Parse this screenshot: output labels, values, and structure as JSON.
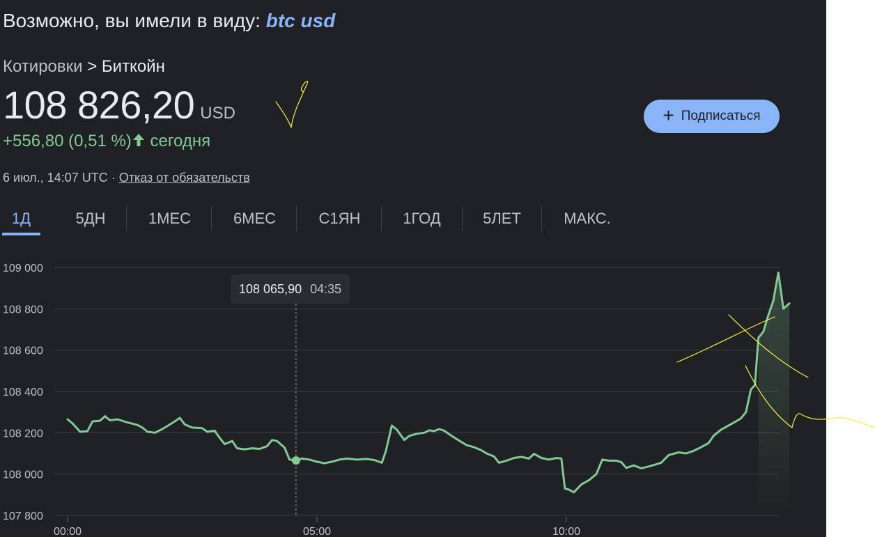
{
  "header": {
    "did_you_mean_prefix": "Возможно, вы имели в виду: ",
    "did_you_mean_query": "btc usd"
  },
  "breadcrumb": {
    "root": "Котировки",
    "separator": " > ",
    "current": "Биткойн"
  },
  "quote": {
    "price": "108 826,20",
    "currency": "USD",
    "change": "+556,80 (0,51 %)",
    "change_suffix": " сегодня",
    "timestamp": "6 июл., 14:07 UTC · ",
    "disclaimer": "Отказ от обязательств"
  },
  "subscribe_label": "Подписаться",
  "tabs": [
    "1Д",
    "5ДН",
    "1МЕС",
    "6МЕС",
    "С1ЯН",
    "1ГОД",
    "5ЛЕТ",
    "МАКС."
  ],
  "active_tab": "1Д",
  "tooltip": {
    "value": "108 065,90",
    "time": "04:35"
  },
  "colors": {
    "line": "#81c995",
    "accent": "#8ab4f8",
    "background": "#202124",
    "annotation": "#f5ef3b"
  },
  "chart_data": {
    "type": "line",
    "yticks": [
      "109 000",
      "108 800",
      "108 600",
      "108 400",
      "108 200",
      "108 000",
      "107 800"
    ],
    "ytick_values": [
      109000,
      108800,
      108600,
      108400,
      108200,
      108000,
      107800
    ],
    "xticks": [
      "00:00",
      "05:00",
      "10:00"
    ],
    "xtick_hours": [
      0,
      5,
      10
    ],
    "ylim": [
      107800,
      109000
    ],
    "grid": true,
    "hover_point": {
      "t": "04:35",
      "value": 108065.9
    },
    "series": [
      {
        "values": [
          [
            0.0,
            108265
          ],
          [
            0.1,
            108245
          ],
          [
            0.25,
            108205
          ],
          [
            0.4,
            108208
          ],
          [
            0.5,
            108255
          ],
          [
            0.65,
            108258
          ],
          [
            0.75,
            108280
          ],
          [
            0.85,
            108260
          ],
          [
            1.0,
            108265
          ],
          [
            1.2,
            108250
          ],
          [
            1.4,
            108238
          ],
          [
            1.5,
            108225
          ],
          [
            1.6,
            108205
          ],
          [
            1.75,
            108200
          ],
          [
            1.9,
            108218
          ],
          [
            2.05,
            108240
          ],
          [
            2.15,
            108255
          ],
          [
            2.25,
            108272
          ],
          [
            2.35,
            108240
          ],
          [
            2.5,
            108225
          ],
          [
            2.7,
            108222
          ],
          [
            2.8,
            108205
          ],
          [
            2.95,
            108210
          ],
          [
            3.05,
            108175
          ],
          [
            3.15,
            108145
          ],
          [
            3.3,
            108160
          ],
          [
            3.4,
            108125
          ],
          [
            3.55,
            108120
          ],
          [
            3.7,
            108125
          ],
          [
            3.85,
            108122
          ],
          [
            4.0,
            108135
          ],
          [
            4.1,
            108165
          ],
          [
            4.2,
            108160
          ],
          [
            4.35,
            108128
          ],
          [
            4.45,
            108070
          ],
          [
            4.58,
            108066
          ],
          [
            4.7,
            108075
          ],
          [
            4.85,
            108070
          ],
          [
            5.0,
            108060
          ],
          [
            5.15,
            108052
          ],
          [
            5.3,
            108060
          ],
          [
            5.45,
            108070
          ],
          [
            5.6,
            108075
          ],
          [
            5.8,
            108070
          ],
          [
            6.0,
            108073
          ],
          [
            6.15,
            108068
          ],
          [
            6.3,
            108055
          ],
          [
            6.38,
            108110
          ],
          [
            6.5,
            108235
          ],
          [
            6.6,
            108215
          ],
          [
            6.75,
            108165
          ],
          [
            6.85,
            108185
          ],
          [
            7.0,
            108195
          ],
          [
            7.15,
            108200
          ],
          [
            7.25,
            108212
          ],
          [
            7.35,
            108208
          ],
          [
            7.45,
            108218
          ],
          [
            7.55,
            108210
          ],
          [
            7.7,
            108185
          ],
          [
            7.85,
            108162
          ],
          [
            8.0,
            108140
          ],
          [
            8.15,
            108130
          ],
          [
            8.3,
            108115
          ],
          [
            8.4,
            108100
          ],
          [
            8.55,
            108085
          ],
          [
            8.65,
            108055
          ],
          [
            8.8,
            108065
          ],
          [
            8.95,
            108078
          ],
          [
            9.1,
            108083
          ],
          [
            9.25,
            108075
          ],
          [
            9.35,
            108098
          ],
          [
            9.5,
            108078
          ],
          [
            9.65,
            108070
          ],
          [
            9.8,
            108078
          ],
          [
            9.9,
            108075
          ],
          [
            9.97,
            107930
          ],
          [
            10.05,
            107925
          ],
          [
            10.15,
            107912
          ],
          [
            10.3,
            107950
          ],
          [
            10.45,
            107970
          ],
          [
            10.6,
            108000
          ],
          [
            10.72,
            108070
          ],
          [
            10.85,
            108065
          ],
          [
            11.0,
            108065
          ],
          [
            11.1,
            108058
          ],
          [
            11.2,
            108030
          ],
          [
            11.35,
            108042
          ],
          [
            11.5,
            108028
          ],
          [
            11.7,
            108040
          ],
          [
            11.9,
            108055
          ],
          [
            12.05,
            108092
          ],
          [
            12.25,
            108105
          ],
          [
            12.4,
            108100
          ],
          [
            12.55,
            108112
          ],
          [
            12.7,
            108130
          ],
          [
            12.85,
            108150
          ],
          [
            12.95,
            108185
          ],
          [
            13.1,
            108215
          ],
          [
            13.25,
            108235
          ],
          [
            13.4,
            108255
          ],
          [
            13.5,
            108270
          ],
          [
            13.6,
            108300
          ],
          [
            13.7,
            108410
          ],
          [
            13.78,
            108430
          ],
          [
            13.85,
            108660
          ],
          [
            13.95,
            108690
          ],
          [
            14.05,
            108770
          ],
          [
            14.15,
            108840
          ],
          [
            14.25,
            108975
          ],
          [
            14.35,
            108800
          ],
          [
            14.47,
            108826
          ]
        ]
      }
    ]
  }
}
